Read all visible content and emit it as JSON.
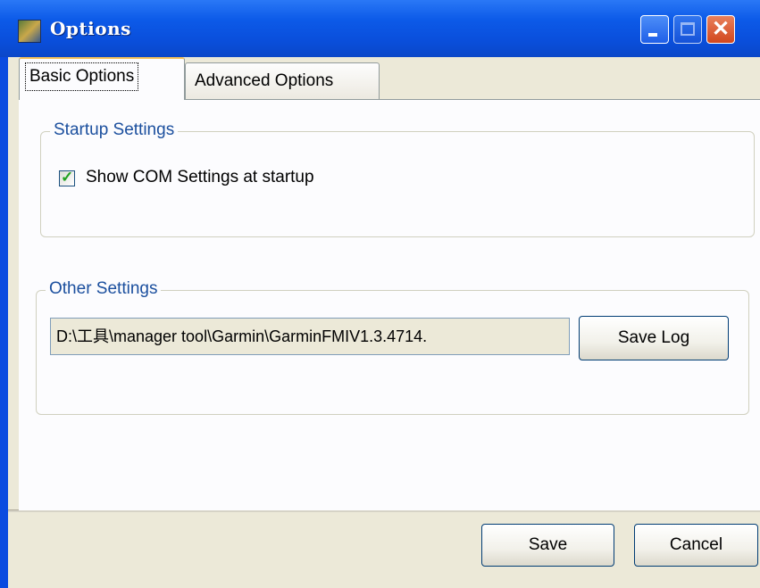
{
  "window": {
    "title": "Options"
  },
  "tabs": [
    {
      "label": "Basic Options",
      "selected": true
    },
    {
      "label": "Advanced Options",
      "selected": false
    }
  ],
  "startup_settings": {
    "legend": "Startup Settings",
    "show_com_checkbox": {
      "label": "Show COM Settings at startup",
      "checked": true
    }
  },
  "other_settings": {
    "legend": "Other Settings",
    "log_path": "D:\\工具\\manager tool\\Garmin\\GarminFMIV1.3.4714.",
    "save_log_label": "Save Log"
  },
  "footer": {
    "save_label": "Save",
    "cancel_label": "Cancel"
  },
  "icons": {
    "close": "close-icon",
    "minimize": "minimize-icon",
    "maximize": "maximize-icon",
    "app": "app-icon",
    "check": "check-icon"
  },
  "colors": {
    "titlebar": "#0a4fdc",
    "accent_text": "#1b4f9e",
    "check": "#21a121",
    "close_button": "#d2471d"
  }
}
